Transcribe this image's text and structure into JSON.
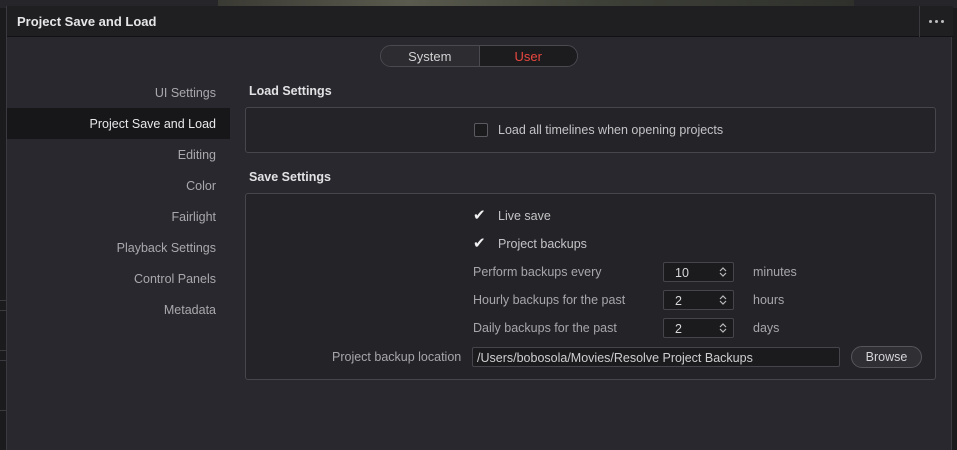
{
  "window": {
    "title": "Project Save and Load",
    "more_icon": "more-horizontal-icon"
  },
  "tabs": {
    "system": "System",
    "user": "User",
    "active": "User",
    "active_color": "#e8473f"
  },
  "sidebar": {
    "items": [
      {
        "label": "UI Settings",
        "active": false
      },
      {
        "label": "Project Save and Load",
        "active": true
      },
      {
        "label": "Editing",
        "active": false
      },
      {
        "label": "Color",
        "active": false
      },
      {
        "label": "Fairlight",
        "active": false
      },
      {
        "label": "Playback Settings",
        "active": false
      },
      {
        "label": "Control Panels",
        "active": false
      },
      {
        "label": "Metadata",
        "active": false
      }
    ]
  },
  "load_settings": {
    "title": "Load Settings",
    "load_all_timelines": {
      "label": "Load all timelines when opening projects",
      "checked": false
    }
  },
  "save_settings": {
    "title": "Save Settings",
    "live_save": {
      "label": "Live save",
      "checked": true
    },
    "project_backups": {
      "label": "Project backups",
      "checked": true
    },
    "perform_backups": {
      "label": "Perform backups every",
      "value": "10",
      "unit": "minutes"
    },
    "hourly_backups": {
      "label": "Hourly backups for the past",
      "value": "2",
      "unit": "hours"
    },
    "daily_backups": {
      "label": "Daily backups for the past",
      "value": "2",
      "unit": "days"
    },
    "backup_location": {
      "label": "Project backup location",
      "value": "/Users/bobosola/Movies/Resolve Project Backups",
      "browse_label": "Browse"
    }
  }
}
